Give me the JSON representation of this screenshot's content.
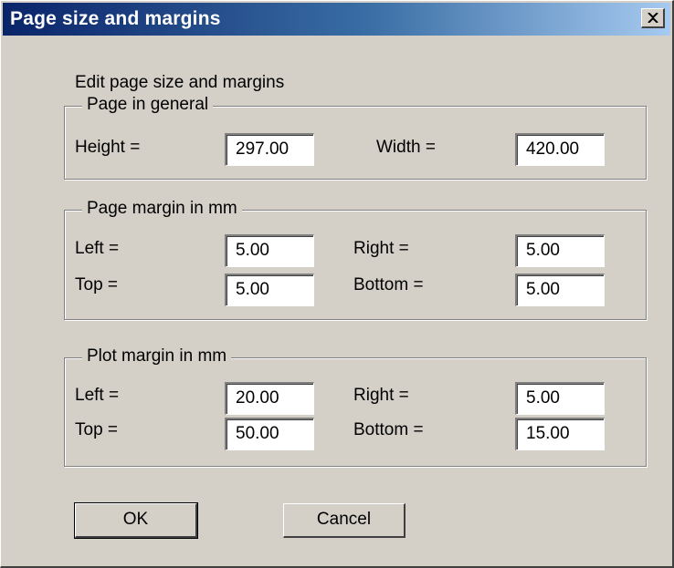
{
  "window": {
    "title": "Page size and margins"
  },
  "dialog": {
    "heading": "Edit page size and margins",
    "page_general": {
      "legend": "Page in general",
      "height_label": "Height =",
      "height_value": "297.00",
      "width_label": "Width =",
      "width_value": "420.00"
    },
    "page_margin": {
      "legend": "Page margin in mm",
      "left_label": "Left =",
      "left_value": "5.00",
      "right_label": "Right =",
      "right_value": "5.00",
      "top_label": "Top =",
      "top_value": "5.00",
      "bottom_label": "Bottom =",
      "bottom_value": "5.00"
    },
    "plot_margin": {
      "legend": "Plot margin in mm",
      "left_label": "Left =",
      "left_value": "20.00",
      "right_label": "Right =",
      "right_value": "5.00",
      "top_label": "Top =",
      "top_value": "50.00",
      "bottom_label": "Bottom =",
      "bottom_value": "15.00"
    },
    "buttons": {
      "ok": "OK",
      "cancel": "Cancel"
    }
  },
  "colors": {
    "titlebar_start": "#0a246a",
    "titlebar_end": "#a6caf0",
    "face": "#d4d0c8"
  },
  "icons": {
    "close": "close-icon"
  }
}
